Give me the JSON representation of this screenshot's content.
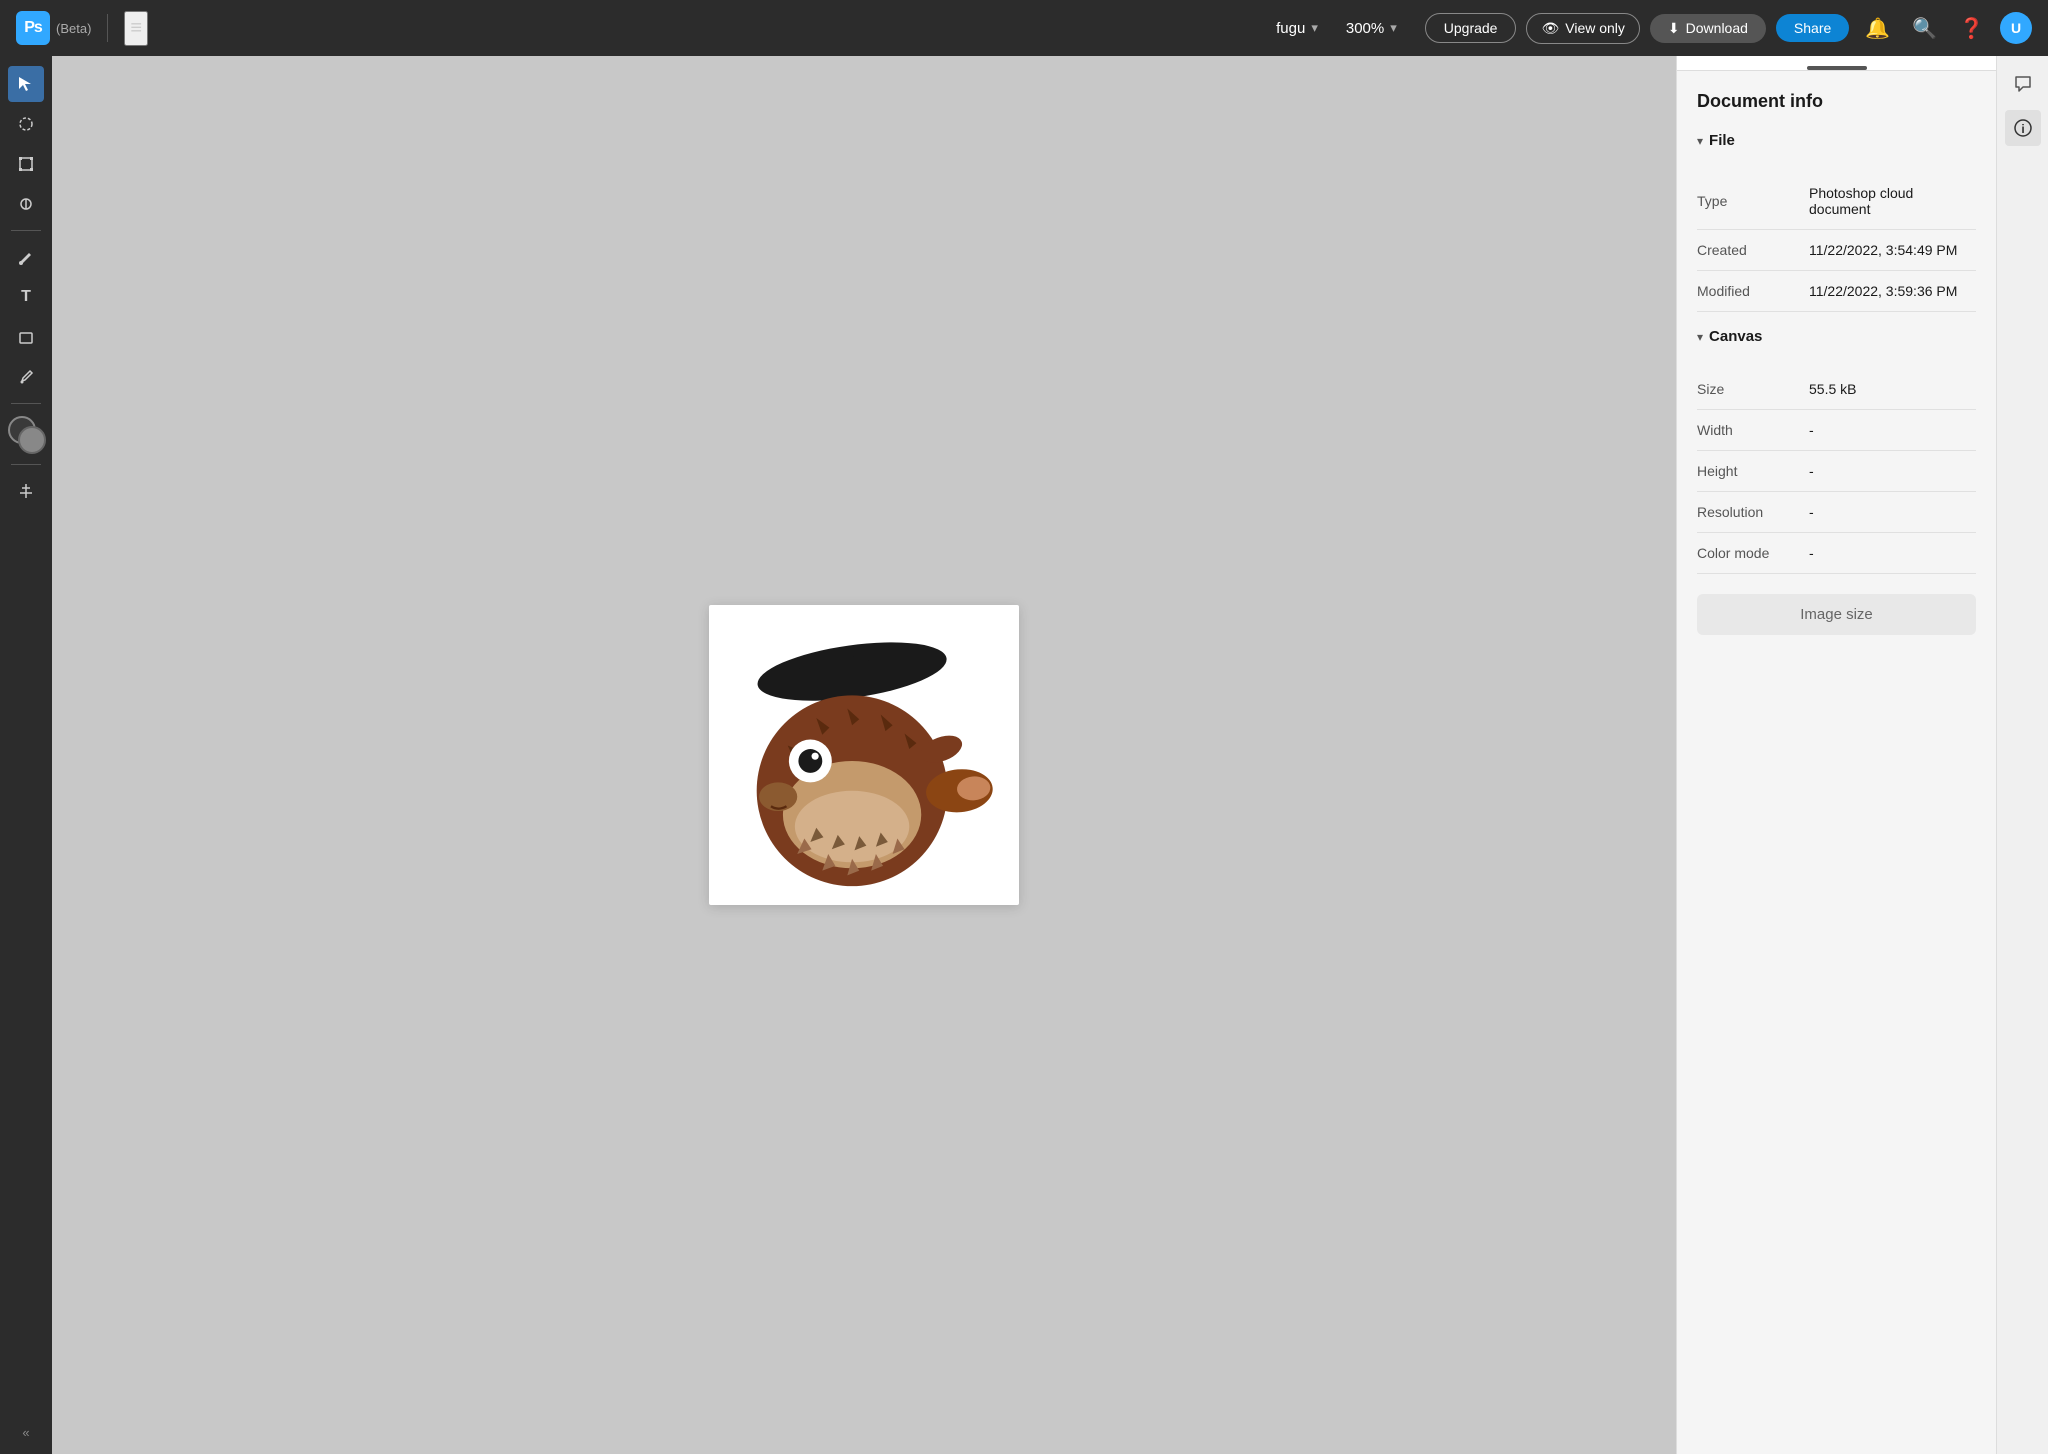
{
  "header": {
    "ps_label": "Ps",
    "beta_label": "(Beta)",
    "filename": "fugu",
    "zoom": "300%",
    "upgrade_label": "Upgrade",
    "view_only_label": "View only",
    "download_label": "Download",
    "share_label": "Share"
  },
  "toolbar": {
    "tools": [
      {
        "name": "select",
        "icon": "↖",
        "active": true
      },
      {
        "name": "lasso",
        "icon": "◯"
      },
      {
        "name": "transform",
        "icon": "⊕"
      },
      {
        "name": "heal",
        "icon": "✦"
      },
      {
        "name": "brush",
        "icon": "✏"
      },
      {
        "name": "text",
        "icon": "T"
      },
      {
        "name": "shape",
        "icon": "❑"
      },
      {
        "name": "eyedropper",
        "icon": "⌀"
      }
    ],
    "collapse_label": "«"
  },
  "panel": {
    "title": "Document info",
    "file_section": "File",
    "canvas_section": "Canvas",
    "type_label": "Type",
    "type_value": "Photoshop cloud document",
    "created_label": "Created",
    "created_value": "11/22/2022, 3:54:49 PM",
    "modified_label": "Modified",
    "modified_value": "11/22/2022, 3:59:36 PM",
    "size_label": "Size",
    "size_value": "55.5 kB",
    "width_label": "Width",
    "width_value": "-",
    "height_label": "Height",
    "height_value": "-",
    "resolution_label": "Resolution",
    "resolution_value": "-",
    "color_mode_label": "Color mode",
    "color_mode_value": "-",
    "image_size_label": "Image size"
  }
}
